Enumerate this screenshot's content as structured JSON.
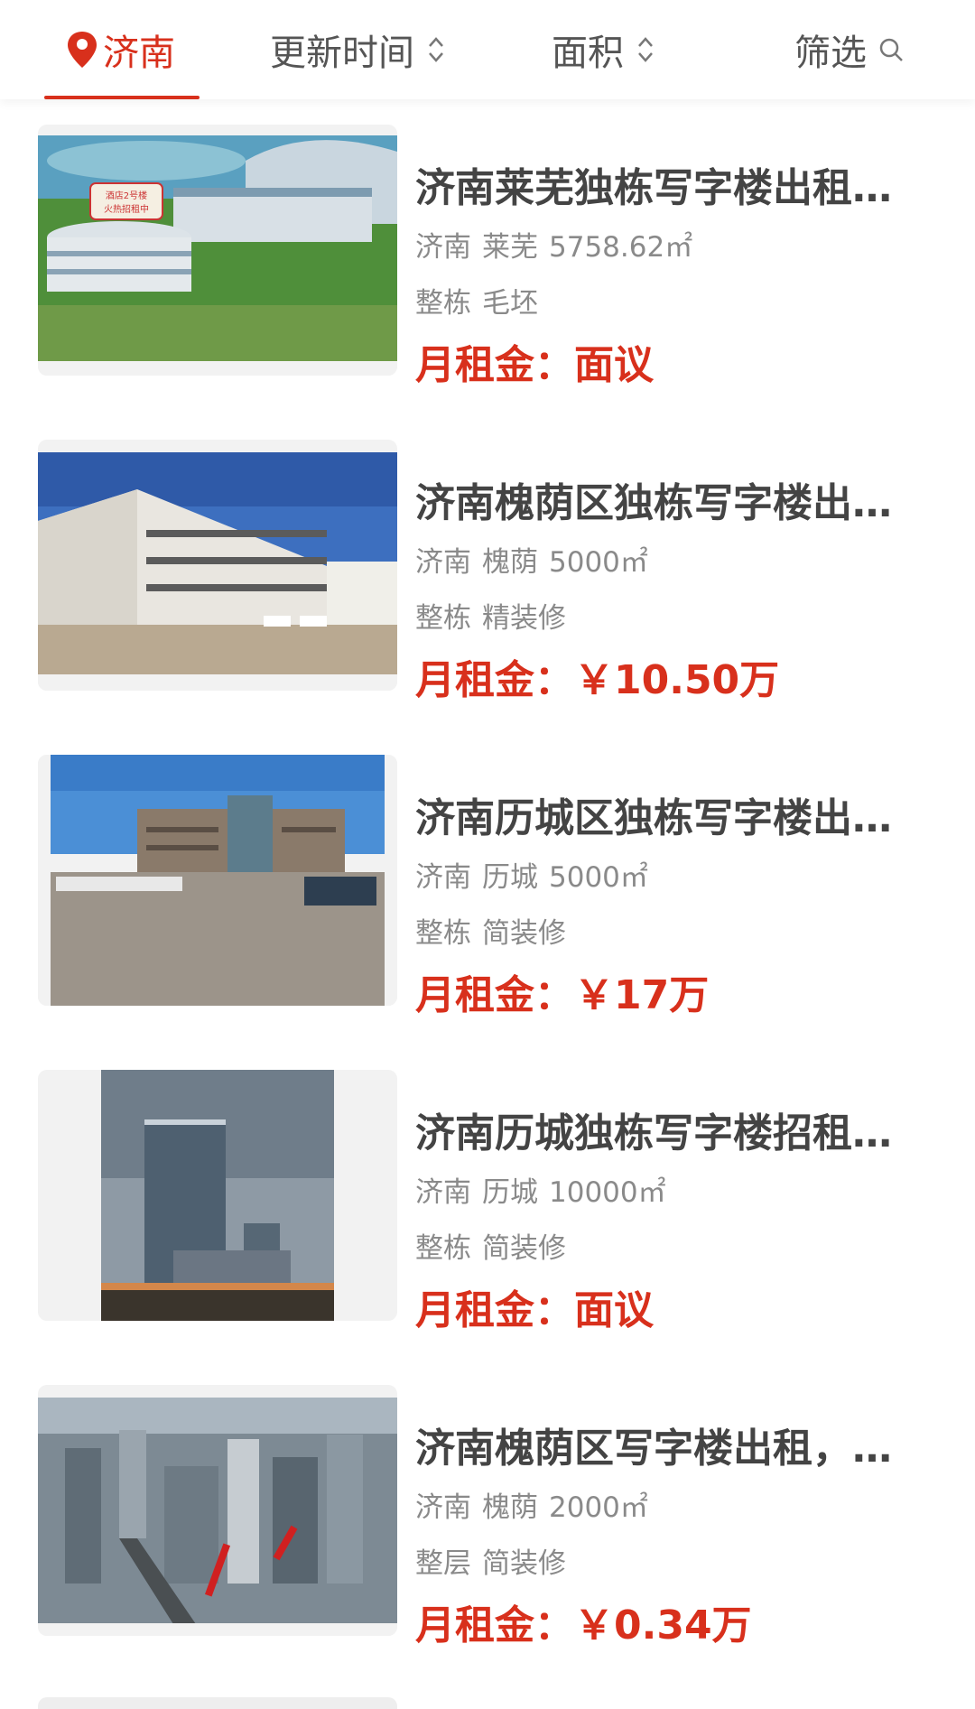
{
  "header": {
    "city_label": "济南",
    "sort_update_label": "更新时间",
    "sort_area_label": "面积",
    "filter_label": "筛选",
    "accent_color": "#d8301c",
    "icons": [
      "location-pin-icon",
      "sort-arrows-icon",
      "search-icon"
    ]
  },
  "listings": [
    {
      "title": "济南莱芜独栋写字楼出租…",
      "city": "济南",
      "district": "莱芜",
      "area": "5758.62㎡",
      "type": "整栋",
      "decoration": "毛坯",
      "rent_label": "月租金：",
      "rent_value": "面议",
      "image_text": "酒店2号楼 火热招租中"
    },
    {
      "title": "济南槐荫区独栋写字楼出…",
      "city": "济南",
      "district": "槐荫",
      "area": "5000㎡",
      "type": "整栋",
      "decoration": "精装修",
      "rent_label": "月租金：",
      "rent_value": "￥10.50万"
    },
    {
      "title": "济南历城区独栋写字楼出…",
      "city": "济南",
      "district": "历城",
      "area": "5000㎡",
      "type": "整栋",
      "decoration": "简装修",
      "rent_label": "月租金：",
      "rent_value": "￥17万"
    },
    {
      "title": "济南历城独栋写字楼招租…",
      "city": "济南",
      "district": "历城",
      "area": "10000㎡",
      "type": "整栋",
      "decoration": "简装修",
      "rent_label": "月租金：",
      "rent_value": "面议"
    },
    {
      "title": "济南槐荫区写字楼出租，…",
      "city": "济南",
      "district": "槐荫",
      "area": "2000㎡",
      "type": "整层",
      "decoration": "简装修",
      "rent_label": "月租金：",
      "rent_value": "￥0.34万"
    }
  ]
}
